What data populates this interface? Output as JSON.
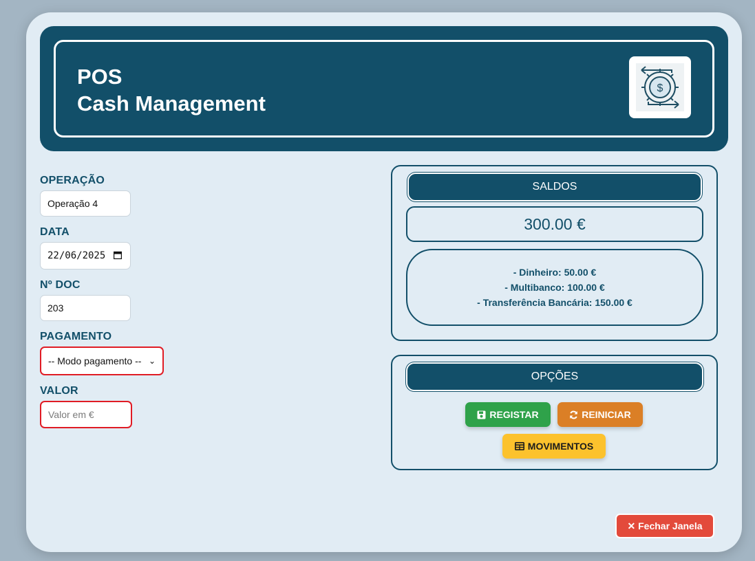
{
  "header": {
    "title_line1": "POS",
    "title_line2": "Cash Management",
    "logo_icon": "cash-flow-dollar-gear-icon"
  },
  "form": {
    "operacao": {
      "label": "OPERAÇÃO",
      "value": "Operação 4"
    },
    "data": {
      "label": "DATA",
      "value": "22/06/2025",
      "icon": "calendar-icon"
    },
    "doc": {
      "label": "Nº DOC",
      "value": "203"
    },
    "pagamento": {
      "label": "PAGAMENTO",
      "selected": "-- Modo pagamento --"
    },
    "valor": {
      "label": "VALOR",
      "placeholder": "Valor em €"
    }
  },
  "saldos": {
    "title": "SALDOS",
    "total": "300.00 €",
    "lines": [
      "- Dinheiro: 50.00 €",
      "- Multibanco: 100.00 €",
      "- Transferência Bancária: 150.00 €"
    ]
  },
  "opcoes": {
    "title": "OPÇÕES",
    "registar": "REGISTAR",
    "reiniciar": "REINICIAR",
    "movimentos": "MOVIMENTOS"
  },
  "footer": {
    "close_label": "✕ Fechar Janela"
  },
  "colors": {
    "primary": "#124f69",
    "background": "#e1ecf4",
    "green": "#2fa24a",
    "orange": "#db7f26",
    "yellow": "#fcc22d",
    "red": "#e34a3b",
    "error_border": "#e01b24"
  }
}
